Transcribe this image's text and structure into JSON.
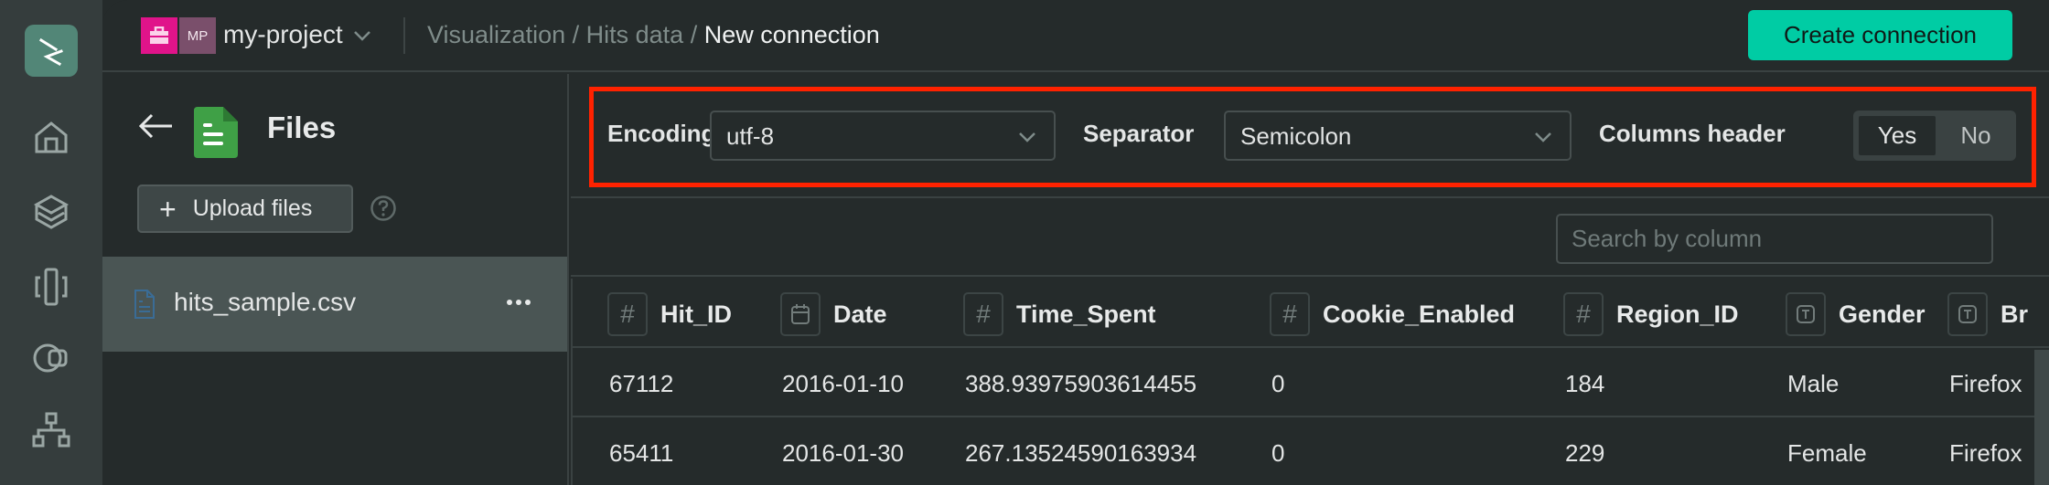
{
  "rail": {
    "items": [
      {
        "name": "home"
      },
      {
        "name": "layers"
      },
      {
        "name": "columns"
      },
      {
        "name": "toggle"
      },
      {
        "name": "hierarchy"
      }
    ]
  },
  "topbar": {
    "workspace_badge_color": "#e0148a",
    "project_initials": "MP",
    "project_name": "my-project",
    "breadcrumb": {
      "items": [
        "Visualization",
        "Hits data"
      ],
      "separator": " / ",
      "current": "New connection"
    },
    "create_button": "Create connection",
    "accent_color": "#00cca4"
  },
  "files_panel": {
    "title": "Files",
    "upload_button": "Upload files",
    "files": [
      {
        "name": "hits_sample.csv",
        "selected": true
      }
    ]
  },
  "options": {
    "encoding_label": "Encoding",
    "encoding_value": "utf-8",
    "separator_label": "Separator",
    "separator_value": "Semicolon",
    "columns_header_label": "Columns header",
    "columns_header_options": [
      "Yes",
      "No"
    ],
    "columns_header_selected": "Yes",
    "highlight_color": "#ff2200"
  },
  "search": {
    "placeholder": "Search by column",
    "value": ""
  },
  "table": {
    "columns": [
      {
        "name": "Hit_ID",
        "type": "number"
      },
      {
        "name": "Date",
        "type": "date"
      },
      {
        "name": "Time_Spent",
        "type": "number"
      },
      {
        "name": "Cookie_Enabled",
        "type": "number"
      },
      {
        "name": "Region_ID",
        "type": "number"
      },
      {
        "name": "Gender",
        "type": "text"
      },
      {
        "name": "Br",
        "type": "text"
      }
    ],
    "rows": [
      [
        "67112",
        "2016-01-10",
        "388.93975903614455",
        "0",
        "184",
        "Male",
        "Firefox"
      ],
      [
        "65411",
        "2016-01-30",
        "267.13524590163934",
        "0",
        "229",
        "Female",
        "Firefox"
      ]
    ]
  }
}
